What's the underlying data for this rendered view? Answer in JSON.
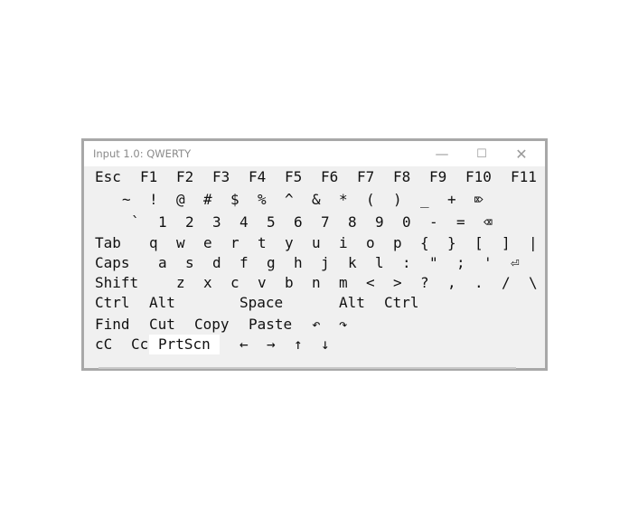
{
  "window": {
    "title": "Input 1.0: QWERTY",
    "minimize_glyph": "—",
    "maximize_glyph": "☐",
    "close_glyph": "✕"
  },
  "keyboard": {
    "rows": [
      [
        {
          "name": "key-esc",
          "label": "Esc"
        },
        {
          "name": "key-f1",
          "label": "F1"
        },
        {
          "name": "key-f2",
          "label": "F2"
        },
        {
          "name": "key-f3",
          "label": "F3"
        },
        {
          "name": "key-f4",
          "label": "F4"
        },
        {
          "name": "key-f5",
          "label": "F5"
        },
        {
          "name": "key-f6",
          "label": "F6"
        },
        {
          "name": "key-f7",
          "label": "F7"
        },
        {
          "name": "key-f8",
          "label": "F8"
        },
        {
          "name": "key-f9",
          "label": "F9"
        },
        {
          "name": "key-f10",
          "label": "F10"
        },
        {
          "name": "key-f11",
          "label": "F11"
        }
      ],
      [
        {
          "name": "key-tilde",
          "label": "~"
        },
        {
          "name": "key-exclamation",
          "label": "!"
        },
        {
          "name": "key-at",
          "label": "@"
        },
        {
          "name": "key-hash",
          "label": "#"
        },
        {
          "name": "key-dollar",
          "label": "$"
        },
        {
          "name": "key-percent",
          "label": "%"
        },
        {
          "name": "key-caret",
          "label": "^"
        },
        {
          "name": "key-ampersand",
          "label": "&"
        },
        {
          "name": "key-asterisk",
          "label": "*"
        },
        {
          "name": "key-paren-left",
          "label": "("
        },
        {
          "name": "key-paren-right",
          "label": ")"
        },
        {
          "name": "key-underscore",
          "label": "_"
        },
        {
          "name": "key-plus",
          "label": "+"
        },
        {
          "name": "key-delete",
          "label": "⌦"
        }
      ],
      [
        {
          "name": "key-backtick",
          "label": "`"
        },
        {
          "name": "key-1",
          "label": "1"
        },
        {
          "name": "key-2",
          "label": "2"
        },
        {
          "name": "key-3",
          "label": "3"
        },
        {
          "name": "key-4",
          "label": "4"
        },
        {
          "name": "key-5",
          "label": "5"
        },
        {
          "name": "key-6",
          "label": "6"
        },
        {
          "name": "key-7",
          "label": "7"
        },
        {
          "name": "key-8",
          "label": "8"
        },
        {
          "name": "key-9",
          "label": "9"
        },
        {
          "name": "key-0",
          "label": "0"
        },
        {
          "name": "key-minus",
          "label": "-"
        },
        {
          "name": "key-equals",
          "label": "="
        },
        {
          "name": "key-backspace",
          "label": "⌫"
        }
      ],
      [
        {
          "name": "key-tab",
          "label": "Tab"
        },
        {
          "name": "key-q",
          "label": "q"
        },
        {
          "name": "key-w",
          "label": "w"
        },
        {
          "name": "key-e",
          "label": "e"
        },
        {
          "name": "key-r",
          "label": "r"
        },
        {
          "name": "key-t",
          "label": "t"
        },
        {
          "name": "key-y",
          "label": "y"
        },
        {
          "name": "key-u",
          "label": "u"
        },
        {
          "name": "key-i",
          "label": "i"
        },
        {
          "name": "key-o",
          "label": "o"
        },
        {
          "name": "key-p",
          "label": "p"
        },
        {
          "name": "key-brace-left",
          "label": "{"
        },
        {
          "name": "key-brace-right",
          "label": "}"
        },
        {
          "name": "key-bracket-left",
          "label": "["
        },
        {
          "name": "key-bracket-right",
          "label": "]"
        },
        {
          "name": "key-pipe",
          "label": "|"
        }
      ],
      [
        {
          "name": "key-caps",
          "label": "Caps"
        },
        {
          "name": "key-a",
          "label": "a"
        },
        {
          "name": "key-s",
          "label": "s"
        },
        {
          "name": "key-d",
          "label": "d"
        },
        {
          "name": "key-f",
          "label": "f"
        },
        {
          "name": "key-g",
          "label": "g"
        },
        {
          "name": "key-h",
          "label": "h"
        },
        {
          "name": "key-j",
          "label": "j"
        },
        {
          "name": "key-k",
          "label": "k"
        },
        {
          "name": "key-l",
          "label": "l"
        },
        {
          "name": "key-colon",
          "label": ":"
        },
        {
          "name": "key-double-quote",
          "label": "\""
        },
        {
          "name": "key-semicolon",
          "label": ";"
        },
        {
          "name": "key-single-quote",
          "label": "'"
        },
        {
          "name": "key-enter",
          "label": "⏎"
        }
      ],
      [
        {
          "name": "key-shift",
          "label": "Shift"
        },
        {
          "name": "key-z",
          "label": "z"
        },
        {
          "name": "key-x",
          "label": "x"
        },
        {
          "name": "key-c",
          "label": "c"
        },
        {
          "name": "key-v",
          "label": "v"
        },
        {
          "name": "key-b",
          "label": "b"
        },
        {
          "name": "key-n",
          "label": "n"
        },
        {
          "name": "key-m",
          "label": "m"
        },
        {
          "name": "key-less-than",
          "label": "<"
        },
        {
          "name": "key-greater-than",
          "label": ">"
        },
        {
          "name": "key-question",
          "label": "?"
        },
        {
          "name": "key-comma",
          "label": ","
        },
        {
          "name": "key-period",
          "label": "."
        },
        {
          "name": "key-slash",
          "label": "/"
        },
        {
          "name": "key-backslash",
          "label": "\\"
        }
      ],
      [
        {
          "name": "key-ctrl-left",
          "label": "Ctrl"
        },
        {
          "name": "key-alt-left",
          "label": "Alt"
        },
        {
          "name": "key-space",
          "label": "Space"
        },
        {
          "name": "key-alt-right",
          "label": "Alt"
        },
        {
          "name": "key-ctrl-right",
          "label": "Ctrl"
        }
      ],
      [
        {
          "name": "key-find",
          "label": "Find"
        },
        {
          "name": "key-cut",
          "label": "Cut"
        },
        {
          "name": "key-copy",
          "label": "Copy"
        },
        {
          "name": "key-paste",
          "label": "Paste"
        },
        {
          "name": "key-undo",
          "label": "↶"
        },
        {
          "name": "key-redo",
          "label": "↷"
        }
      ],
      [
        {
          "name": "key-cc-lower",
          "label": "cC"
        },
        {
          "name": "key-cc-upper",
          "label": "Cc"
        },
        {
          "name": "key-prtscn",
          "label": "PrtScn",
          "highlighted": true
        },
        {
          "name": "key-arrow-left",
          "label": "←"
        },
        {
          "name": "key-arrow-right",
          "label": "→"
        },
        {
          "name": "key-arrow-up",
          "label": "↑"
        },
        {
          "name": "key-arrow-down",
          "label": "↓"
        }
      ]
    ]
  }
}
